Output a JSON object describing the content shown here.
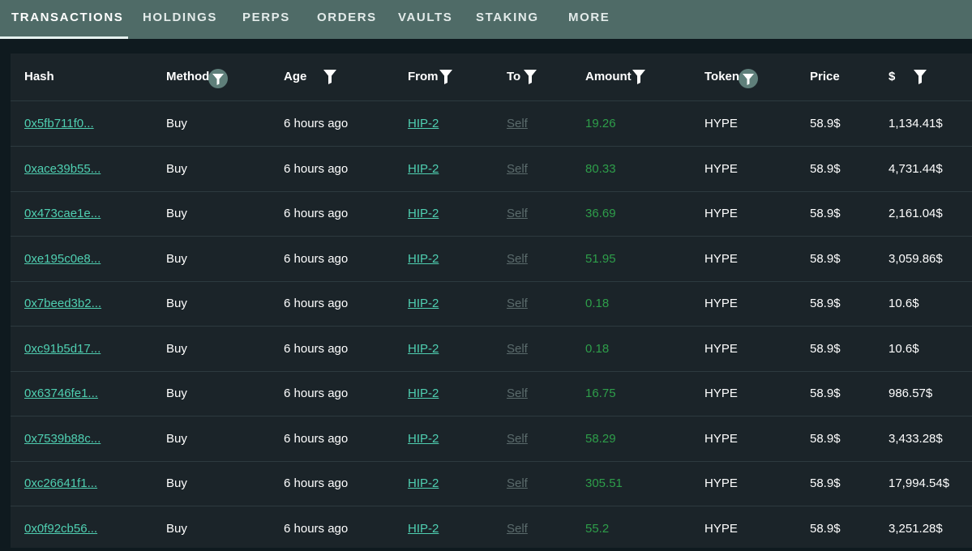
{
  "tabs": [
    {
      "label": "TRANSACTIONS",
      "active": true
    },
    {
      "label": "HOLDINGS"
    },
    {
      "label": "PERPS"
    },
    {
      "label": "ORDERS"
    },
    {
      "label": "VAULTS"
    },
    {
      "label": "STAKING"
    },
    {
      "label": "MORE"
    }
  ],
  "table": {
    "columns": [
      {
        "label": "Hash"
      },
      {
        "label": "Method",
        "filter_icon": "filter-circle-icon"
      },
      {
        "label": "Age",
        "filter_icon": "filter-icon"
      },
      {
        "label": "From",
        "filter_icon": "filter-icon"
      },
      {
        "label": "To",
        "filter_icon": "filter-icon"
      },
      {
        "label": "Amount",
        "filter_icon": "filter-icon"
      },
      {
        "label": "Token",
        "filter_icon": "filter-circle-icon"
      },
      {
        "label": "Price"
      },
      {
        "label": "$",
        "filter_icon": "filter-icon"
      }
    ],
    "rows": [
      {
        "hash": "0x5fb711f0...",
        "method": "Buy",
        "age": "6 hours ago",
        "from": "HIP-2",
        "to": "Self",
        "amount": "19.26",
        "token": "HYPE",
        "price": "58.9$",
        "usd": "1,134.41$"
      },
      {
        "hash": "0xace39b55...",
        "method": "Buy",
        "age": "6 hours ago",
        "from": "HIP-2",
        "to": "Self",
        "amount": "80.33",
        "token": "HYPE",
        "price": "58.9$",
        "usd": "4,731.44$"
      },
      {
        "hash": "0x473cae1e...",
        "method": "Buy",
        "age": "6 hours ago",
        "from": "HIP-2",
        "to": "Self",
        "amount": "36.69",
        "token": "HYPE",
        "price": "58.9$",
        "usd": "2,161.04$"
      },
      {
        "hash": "0xe195c0e8...",
        "method": "Buy",
        "age": "6 hours ago",
        "from": "HIP-2",
        "to": "Self",
        "amount": "51.95",
        "token": "HYPE",
        "price": "58.9$",
        "usd": "3,059.86$"
      },
      {
        "hash": "0x7beed3b2...",
        "method": "Buy",
        "age": "6 hours ago",
        "from": "HIP-2",
        "to": "Self",
        "amount": "0.18",
        "token": "HYPE",
        "price": "58.9$",
        "usd": "10.6$"
      },
      {
        "hash": "0xc91b5d17...",
        "method": "Buy",
        "age": "6 hours ago",
        "from": "HIP-2",
        "to": "Self",
        "amount": "0.18",
        "token": "HYPE",
        "price": "58.9$",
        "usd": "10.6$"
      },
      {
        "hash": "0x63746fe1...",
        "method": "Buy",
        "age": "6 hours ago",
        "from": "HIP-2",
        "to": "Self",
        "amount": "16.75",
        "token": "HYPE",
        "price": "58.9$",
        "usd": "986.57$"
      },
      {
        "hash": "0x7539b88c...",
        "method": "Buy",
        "age": "6 hours ago",
        "from": "HIP-2",
        "to": "Self",
        "amount": "58.29",
        "token": "HYPE",
        "price": "58.9$",
        "usd": "3,433.28$"
      },
      {
        "hash": "0xc26641f1...",
        "method": "Buy",
        "age": "6 hours ago",
        "from": "HIP-2",
        "to": "Self",
        "amount": "305.51",
        "token": "HYPE",
        "price": "58.9$",
        "usd": "17,994.54$"
      },
      {
        "hash": "0x0f92cb56...",
        "method": "Buy",
        "age": "6 hours ago",
        "from": "HIP-2",
        "to": "Self",
        "amount": "55.2",
        "token": "HYPE",
        "price": "58.9$",
        "usd": "3,251.28$"
      }
    ]
  },
  "colors": {
    "tabbar_bg": "#4f6b67",
    "page_bg": "#0f1a1f",
    "table_bg": "#1b2429",
    "link": "#4fcfb1",
    "self_link": "#5b6b6c",
    "amount": "#2e9e4a"
  }
}
